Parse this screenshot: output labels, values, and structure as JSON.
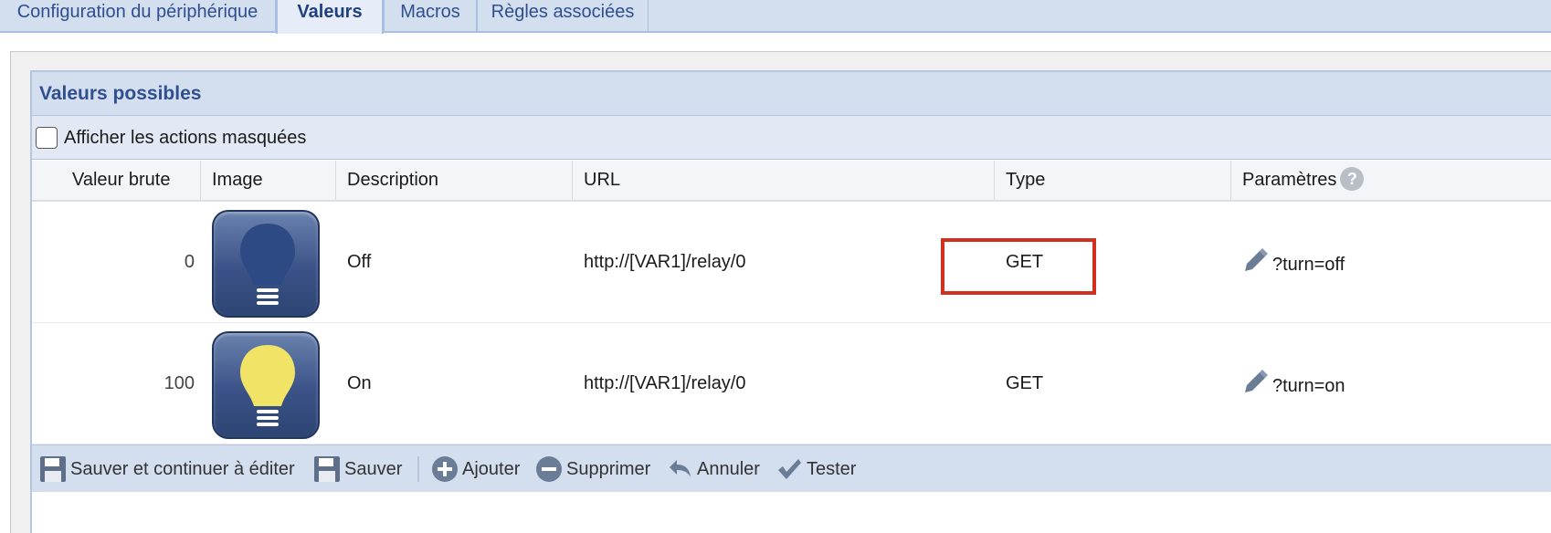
{
  "tabs": [
    {
      "label": "Configuration du périphérique"
    },
    {
      "label": "Valeurs"
    },
    {
      "label": "Macros"
    },
    {
      "label": "Règles associées"
    }
  ],
  "panel": {
    "title": "Valeurs possibles",
    "show_hidden_label": "Afficher les actions masquées",
    "show_hidden_checked": false
  },
  "table": {
    "headers": {
      "raw": "Valeur brute",
      "image": "Image",
      "description": "Description",
      "url": "URL",
      "type": "Type",
      "params": "Paramètres"
    },
    "rows": [
      {
        "raw": "0",
        "image": "bulb-off-icon",
        "description": "Off",
        "url": "http://[VAR1]/relay/0",
        "type": "GET",
        "params": "?turn=off"
      },
      {
        "raw": "100",
        "image": "bulb-on-icon",
        "description": "On",
        "url": "http://[VAR1]/relay/0",
        "type": "GET",
        "params": "?turn=on"
      }
    ]
  },
  "toolbar": {
    "save_continue": "Sauver et continuer à éditer",
    "save": "Sauver",
    "add": "Ajouter",
    "delete": "Supprimer",
    "cancel": "Annuler",
    "test": "Tester"
  },
  "colors": {
    "accent": "#2f4f8f",
    "highlight": "#d1301e",
    "bulb_off": "#2d4a85",
    "bulb_on": "#f0e366"
  }
}
